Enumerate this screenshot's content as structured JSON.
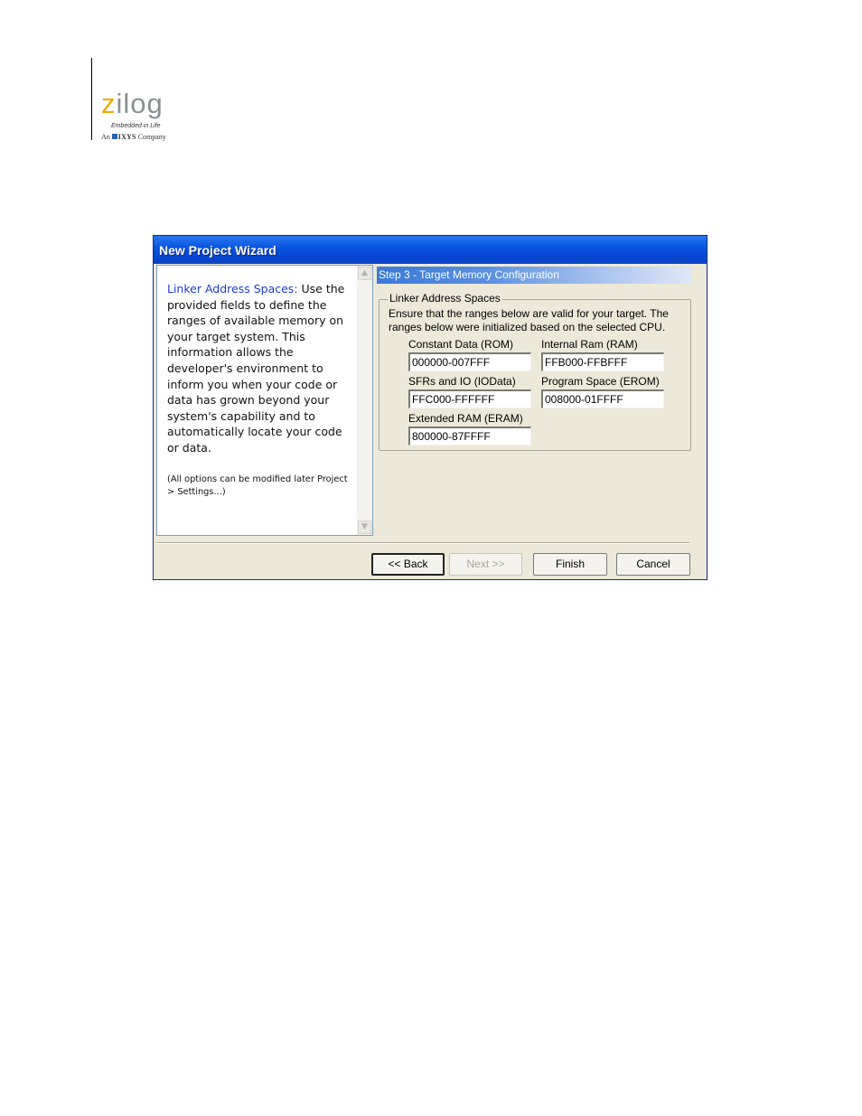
{
  "header": {
    "logo_text": "zilog",
    "tagline": "Embedded in Life",
    "parent_prefix": "An",
    "parent_brand": "IXYS",
    "parent_suffix": "Company"
  },
  "dialog": {
    "title": "New Project Wizard",
    "left_pane": {
      "highlight": "Linker Address Spaces:",
      "body": " Use the provided fields to define the ranges of available memory on your target system. This information allows the developer's environment to inform you when your code or data has grown beyond your system's capability and to automatically locate your code or data.",
      "note": "(All options can be modified later Project > Settings...)"
    },
    "step_title": "Step 3 - Target Memory Configuration",
    "group_title": "Linker Address Spaces",
    "description": "Ensure that the ranges below are valid for your target.  The ranges below were initialized based on the selected CPU.",
    "fields": {
      "constant_data": {
        "label": "Constant Data (ROM)",
        "value": "000000-007FFF"
      },
      "internal_ram": {
        "label": "Internal Ram (RAM)",
        "value": "FFB000-FFBFFF"
      },
      "sfrs_io": {
        "label": "SFRs and IO (IOData)",
        "value": "FFC000-FFFFFF"
      },
      "program_space": {
        "label": "Program Space (EROM)",
        "value": "008000-01FFFF"
      },
      "extended_ram": {
        "label": "Extended RAM (ERAM)",
        "value": "800000-87FFFF"
      }
    },
    "buttons": {
      "back": "<< Back",
      "next": "Next >>",
      "finish": "Finish",
      "cancel": "Cancel"
    }
  },
  "colors": {
    "titlebar": "#0a56e0",
    "link_blue": "#1c3cd0",
    "dialog_face": "#ece9d8"
  }
}
